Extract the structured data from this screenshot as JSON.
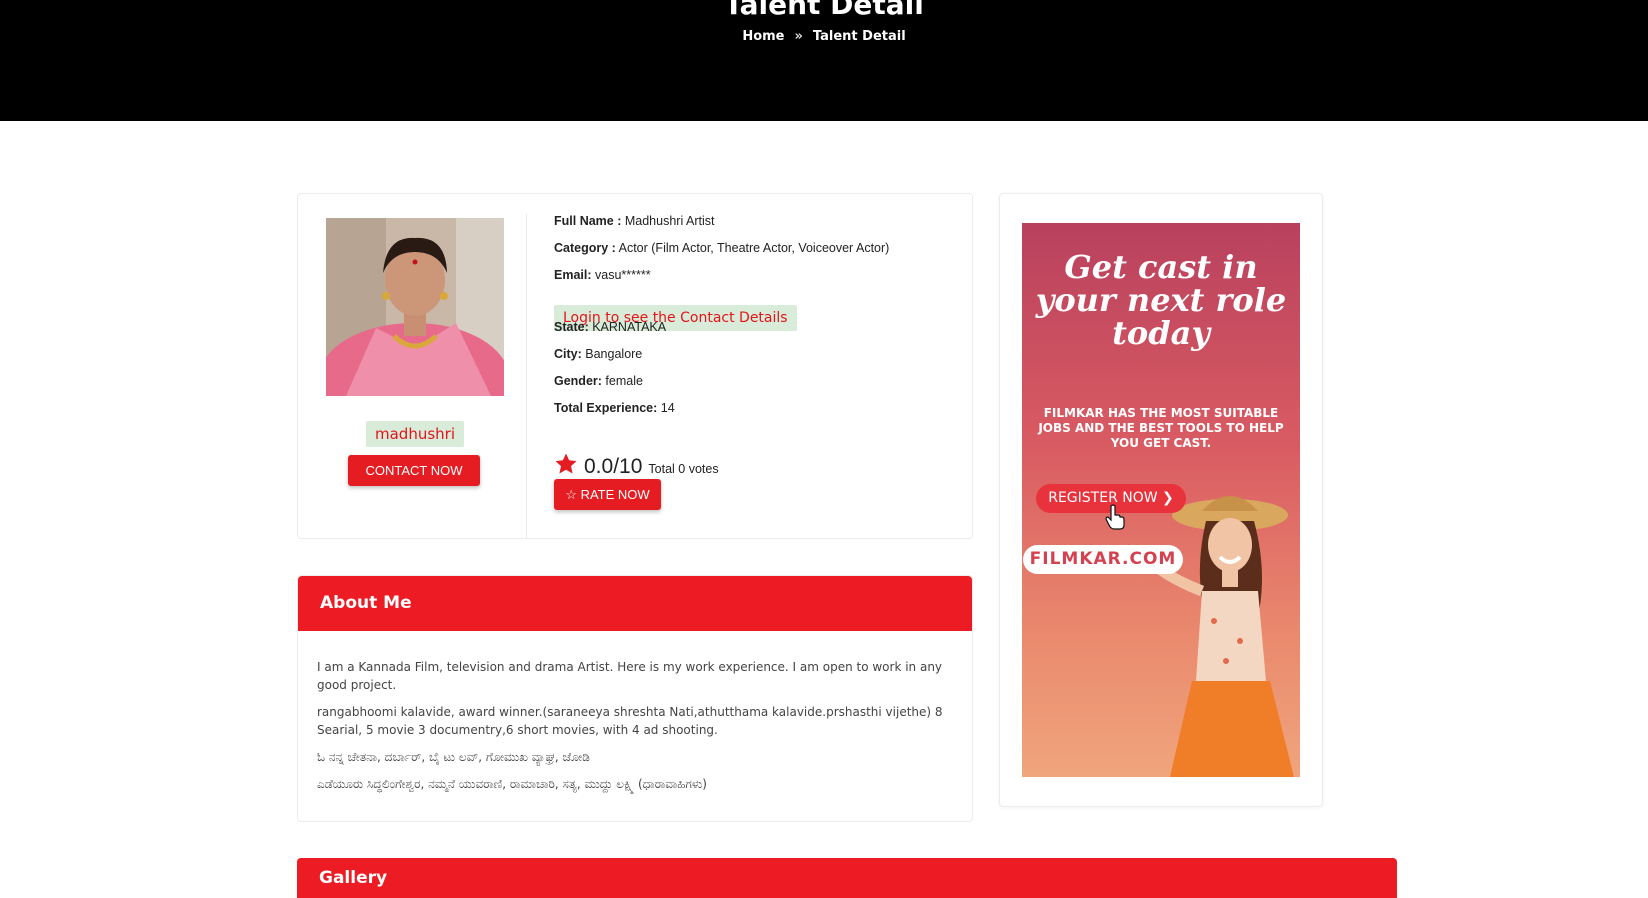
{
  "header": {
    "title": "Talent Detail",
    "breadcrumb": {
      "home": "Home",
      "current": "Talent Detail"
    }
  },
  "profile": {
    "username": "madhushri",
    "contact_button": "CONTACT NOW",
    "fields": {
      "full_name_label": "Full Name :",
      "full_name": "Madhushri Artist",
      "category_label": "Category :",
      "category": "Actor (Film Actor, Theatre Actor, Voiceover Actor)",
      "email_label": "Email:",
      "email": "vasu******",
      "login_prompt": "Login to see the Contact Details",
      "state_label": "State:",
      "state": "KARNATAKA",
      "city_label": "City:",
      "city": "Bangalore",
      "gender_label": "Gender:",
      "gender": "female",
      "experience_label": "Total Experience:",
      "experience": "14"
    },
    "rating": {
      "score": "0.0/10",
      "votes": "Total 0 votes",
      "star_icon": "star-icon",
      "star_color": "#e51c22"
    },
    "rate_button": "☆ RATE NOW"
  },
  "about": {
    "heading": "About Me",
    "paragraphs": [
      "I am a Kannada Film, television and drama Artist. Here is my work experience. I am open to work in any good project.",
      "rangabhoomi  kalavide, award winner.(saraneeya shreshta Nati,athutthama kalavide.prshasthi vijethe) 8 Searial, 5 movie 3 documentry,6 short movies, with 4 ad shooting.",
      "ಓ ನನ್ನ ಚೇತನಾ, ದರ್ಬಾರ್, ಬೈ ಟು ಲವ್, ಗೋಮುಖ ವ್ಯಾಘ್ರ, ಜೋಡಿ",
      "ಎಡೆಯೂರು ಸಿದ್ಧಲಿಂಗೇಶ್ವರ, ನಮ್ಮನೆ ಯುವರಾಣಿ, ರಾಮಾಚಾರಿ, ಸತ್ಯ, ಮುದ್ದು ಲಕ್ಷ್ಮಿ (ಧಾರಾವಾಹಿಗಳು)"
    ]
  },
  "ad": {
    "headline": "Get cast in your next role today",
    "sub": "FILMKAR HAS THE MOST SUITABLE JOBS AND THE BEST TOOLS  TO HELP YOU GET CAST.",
    "register": "REGISTER  NOW ❯",
    "site": "FILMKAR.COM"
  },
  "gallery": {
    "heading": "Gallery"
  },
  "colors": {
    "accent": "#ed1c24",
    "badge_bg": "#d9ecd9",
    "hero_bg": "#000000"
  }
}
